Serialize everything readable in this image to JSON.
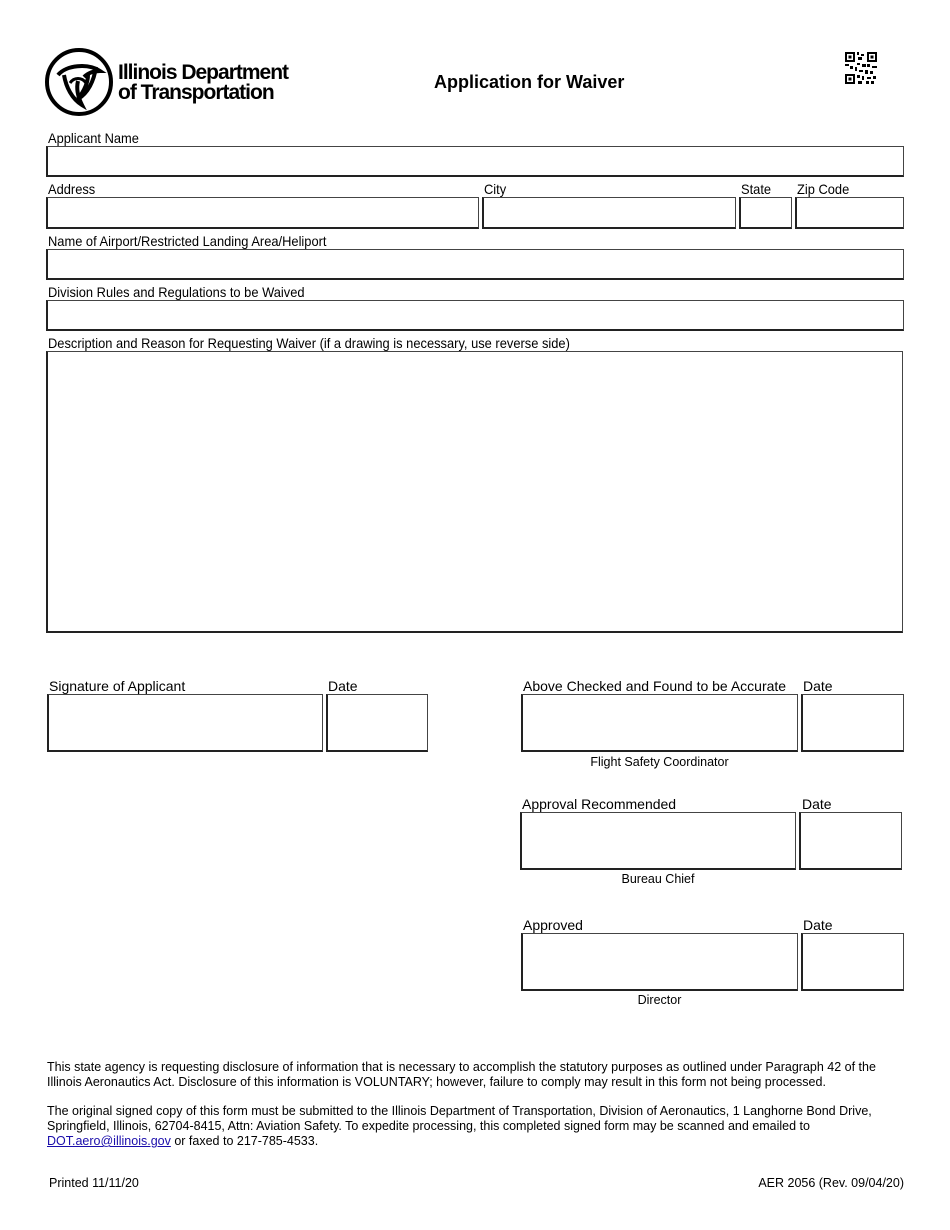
{
  "header": {
    "agency_line1": "Illinois Department",
    "agency_line2": "of Transportation",
    "title": "Application for Waiver",
    "logo_icon": "idot-trefoil-logo",
    "qr_icon": "qr-code"
  },
  "fields": {
    "applicant_name": {
      "label": "Applicant Name",
      "value": ""
    },
    "address": {
      "label": "Address",
      "value": ""
    },
    "city": {
      "label": "City",
      "value": ""
    },
    "state": {
      "label": "State",
      "value": ""
    },
    "zip": {
      "label": "Zip Code",
      "value": ""
    },
    "airport": {
      "label": "Name of Airport/Restricted Landing Area/Heliport",
      "value": ""
    },
    "rules": {
      "label": "Division Rules and Regulations to be Waived",
      "value": ""
    },
    "description": {
      "label": "Description and Reason for Requesting Waiver (if a drawing is necessary, use reverse side)",
      "value": ""
    }
  },
  "signatures": {
    "applicant": {
      "label": "Signature of Applicant",
      "date_label": "Date"
    },
    "checked": {
      "label": "Above Checked and Found to be Accurate",
      "date_label": "Date",
      "caption": "Flight Safety Coordinator"
    },
    "recommended": {
      "label": "Approval Recommended",
      "date_label": "Date",
      "caption": "Bureau Chief"
    },
    "approved": {
      "label": "Approved",
      "date_label": "Date",
      "caption": "Director"
    }
  },
  "notices": {
    "disclosure_line1": "This state agency is requesting disclosure of information that is necessary to accomplish the statutory purposes as outlined under Paragraph 42 of the",
    "disclosure_line2": "Illinois Aeronautics Act.  Disclosure of this information is VOLUNTARY; however, failure to comply may result in this form not being processed.",
    "submit_line1": "The original signed copy of this form must be submitted to the Illinois Department of Transportation, Division of Aeronautics, 1 Langhorne Bond Drive,",
    "submit_line2": "Springfield, Illinois, 62704-8415, Attn: Aviation Safety.  To expedite processing, this completed signed form may be scanned and emailed to",
    "email_link": "DOT.aero@illinois.gov",
    "submit_line3_rest": " or faxed to 217-785-4533."
  },
  "footer": {
    "printed": "Printed 11/11/20",
    "form_id": "AER 2056 (Rev. 09/04/20)"
  }
}
